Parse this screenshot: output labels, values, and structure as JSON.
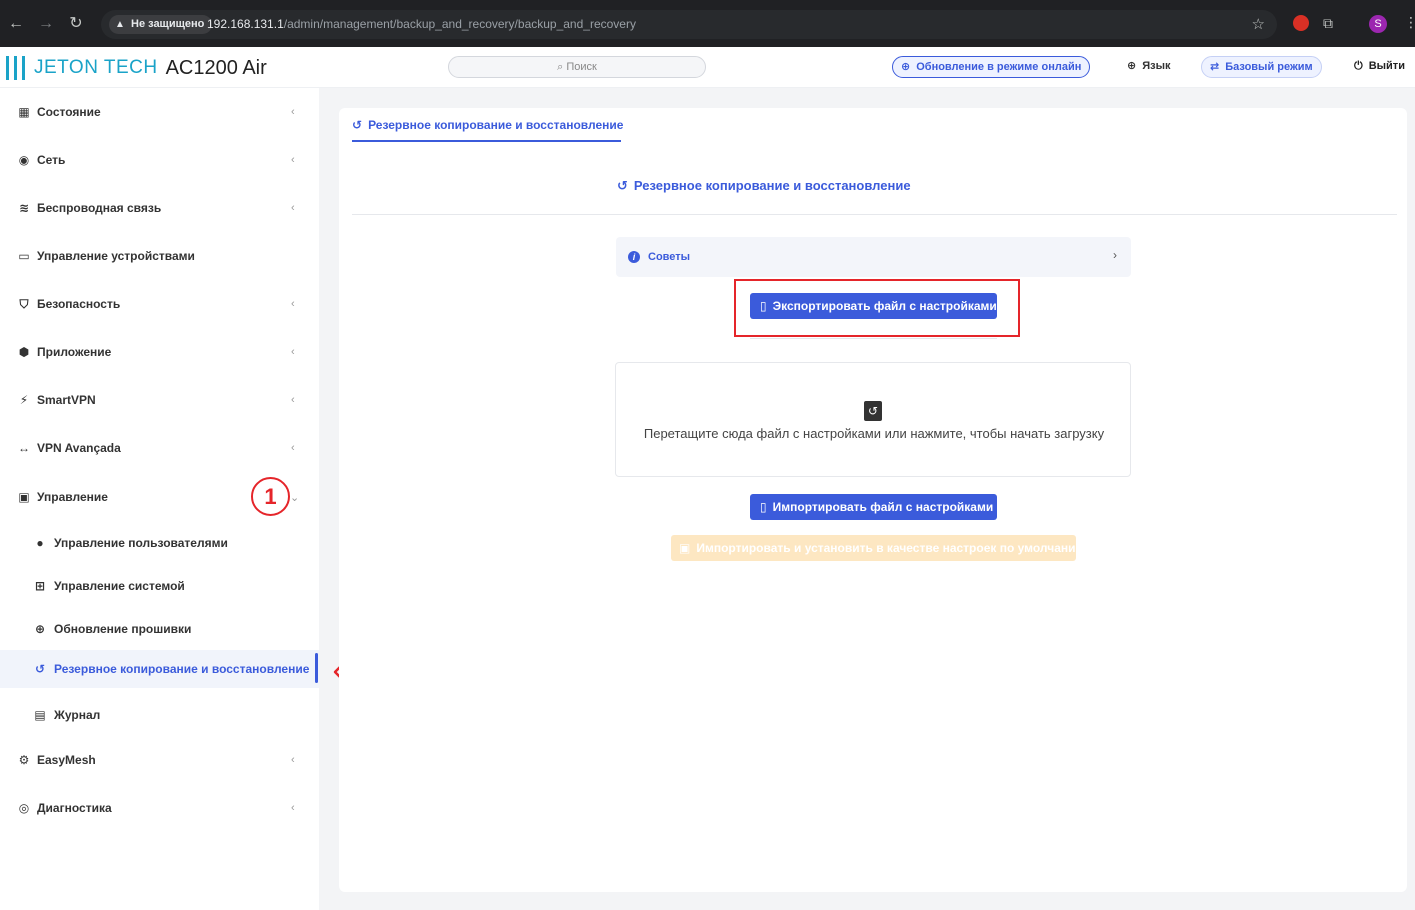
{
  "browser": {
    "insecure_label": "Не защищено",
    "url_host": "192.168.131.1",
    "url_path": "/admin/management/backup_and_recovery/backup_and_recovery",
    "profile_initial": "S"
  },
  "header": {
    "brand": "JETON TECH",
    "model": "AC1200 Air",
    "search_placeholder": "Поиск",
    "online_update": "Обновление в режиме онлайн",
    "language": "Язык",
    "basic_mode": "Базовый режим",
    "logout": "Выйти"
  },
  "sidebar": {
    "items": [
      {
        "label": "Состояние",
        "icon": "grid-icon"
      },
      {
        "label": "Сеть",
        "icon": "globe-icon"
      },
      {
        "label": "Беспроводная связь",
        "icon": "wifi-icon"
      },
      {
        "label": "Управление устройствами",
        "icon": "monitor-icon"
      },
      {
        "label": "Безопасность",
        "icon": "shield-icon"
      },
      {
        "label": "Приложение",
        "icon": "cube-icon"
      },
      {
        "label": "SmartVPN",
        "icon": "plug-icon"
      },
      {
        "label": "VPN Avançada",
        "icon": "arrows-icon"
      },
      {
        "label": "Управление",
        "icon": "briefcase-icon"
      },
      {
        "label": "EasyMesh",
        "icon": "gear-icon"
      },
      {
        "label": "Диагностика",
        "icon": "radar-icon"
      }
    ],
    "subitems": [
      {
        "label": "Управление пользователями",
        "icon": "user-icon"
      },
      {
        "label": "Управление системой",
        "icon": "router-icon"
      },
      {
        "label": "Обновление прошивки",
        "icon": "upload-circle-icon"
      },
      {
        "label": "Резервное копирование и восстановление",
        "icon": "history-icon"
      },
      {
        "label": "Журнал",
        "icon": "log-icon"
      }
    ]
  },
  "annotation": {
    "step": "1"
  },
  "main": {
    "tab_label": "Резервное копирование и восстановление",
    "section_title": "Резервное копирование и восстановление",
    "tips_label": "Советы",
    "export_button": "Экспортировать файл с настройками",
    "dropzone_text": "Перетащите сюда файл с настройками или нажмите, чтобы начать загрузку",
    "import_button": "Импортировать файл с настройками",
    "import_default_button": "Импортировать и установить в качестве настроек по умолчанию"
  },
  "colors": {
    "accent": "#3b5bdb",
    "brand": "#1aa3c8",
    "annotation": "#e5252a",
    "disabled": "#fde7c2"
  }
}
